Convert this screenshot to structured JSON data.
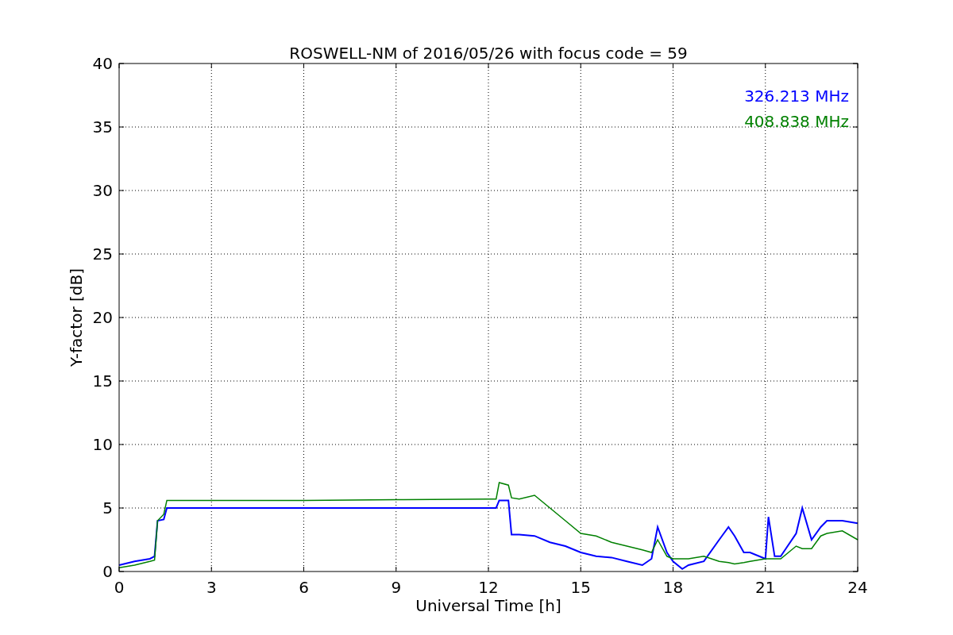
{
  "chart_data": {
    "type": "line",
    "title": "ROSWELL-NM of 2016/05/26 with focus code = 59",
    "xlabel": "Universal Time [h]",
    "ylabel": "Y-factor [dB]",
    "x": [
      0,
      0.5,
      1,
      1.15,
      1.25,
      1.45,
      1.55,
      3,
      6,
      9,
      12,
      12.25,
      12.35,
      12.65,
      12.75,
      13,
      13.5,
      14,
      14.5,
      15,
      15.5,
      16,
      16.5,
      17,
      17.3,
      17.5,
      17.8,
      18,
      18.3,
      18.5,
      19,
      19.5,
      19.8,
      20,
      20.3,
      20.5,
      21,
      21.1,
      21.3,
      21.5,
      22,
      22.2,
      22.5,
      22.8,
      23,
      23.5,
      24
    ],
    "series": [
      {
        "name": "326.213 MHz",
        "color": "#0000ff",
        "values": [
          0.5,
          0.8,
          1.0,
          1.2,
          4.0,
          4.1,
          5.0,
          5.0,
          5.0,
          5.0,
          5.0,
          5.0,
          5.6,
          5.6,
          2.9,
          2.9,
          2.8,
          2.3,
          2.0,
          1.5,
          1.2,
          1.1,
          0.8,
          0.5,
          1.0,
          3.5,
          1.5,
          0.8,
          0.2,
          0.5,
          0.8,
          2.5,
          3.5,
          2.8,
          1.5,
          1.5,
          1.0,
          4.3,
          1.2,
          1.2,
          3.0,
          5.0,
          2.5,
          3.5,
          4.0,
          4.0,
          3.8
        ]
      },
      {
        "name": "408.838 MHz",
        "color": "#008000",
        "values": [
          0.3,
          0.5,
          0.8,
          0.9,
          4.0,
          4.5,
          5.6,
          5.6,
          5.6,
          5.65,
          5.7,
          5.7,
          7.0,
          6.8,
          5.8,
          5.7,
          6.0,
          5.0,
          4.0,
          3.0,
          2.8,
          2.3,
          2.0,
          1.7,
          1.5,
          2.5,
          1.2,
          1.0,
          1.0,
          1.0,
          1.2,
          0.8,
          0.7,
          0.6,
          0.7,
          0.8,
          1.0,
          1.0,
          1.0,
          1.0,
          2.0,
          1.8,
          1.8,
          2.8,
          3.0,
          3.2,
          2.5
        ]
      }
    ],
    "grid": true,
    "xlim": [
      0,
      24
    ],
    "ylim": [
      0,
      40
    ],
    "xticks": [
      0,
      3,
      6,
      9,
      12,
      15,
      18,
      21,
      24
    ],
    "yticks": [
      0,
      5,
      10,
      15,
      20,
      25,
      30,
      35,
      40
    ]
  }
}
